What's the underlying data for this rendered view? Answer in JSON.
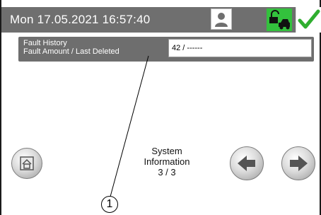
{
  "header": {
    "datetime": "Mon 17.05.2021  16:57:40",
    "icons": {
      "user": "user-icon",
      "lock_vehicle": "unlock-vehicle-icon",
      "confirm": "checkmark-icon"
    },
    "colors": {
      "bar": "#6f6f6f",
      "lock_bg": "#33c13d",
      "check": "#2fae2f"
    }
  },
  "fault": {
    "label_line1": "Fault History",
    "label_line2": "Fault Amount / Last Deleted",
    "value": "42 / ------"
  },
  "footer": {
    "page_line1": "System",
    "page_line2": "Information",
    "page_line3": "3 / 3",
    "icons": {
      "home": "home-icon",
      "prev": "arrow-left-icon",
      "next": "arrow-right-icon"
    }
  },
  "annotation": {
    "callout_number": "1"
  }
}
